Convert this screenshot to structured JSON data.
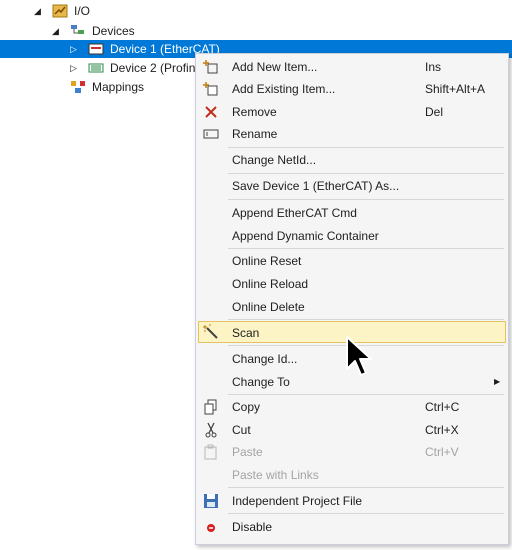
{
  "tree": {
    "io_label": "I/O",
    "devices_label": "Devices",
    "device1_label": "Device 1 (EtherCAT)",
    "device2_label": "Device 2 (Profin",
    "mappings_label": "Mappings"
  },
  "menu": {
    "add_new_item": "Add New Item...",
    "add_new_item_shortcut": "Ins",
    "add_existing_item": "Add Existing Item...",
    "add_existing_item_shortcut": "Shift+Alt+A",
    "remove": "Remove",
    "remove_shortcut": "Del",
    "rename": "Rename",
    "change_netid": "Change NetId...",
    "save_device_as": "Save Device 1 (EtherCAT) As...",
    "append_ethercat_cmd": "Append EtherCAT Cmd",
    "append_dynamic_container": "Append Dynamic Container",
    "online_reset": "Online Reset",
    "online_reload": "Online Reload",
    "online_delete": "Online Delete",
    "scan": "Scan",
    "change_id": "Change Id...",
    "change_to": "Change To",
    "copy": "Copy",
    "copy_shortcut": "Ctrl+C",
    "cut": "Cut",
    "cut_shortcut": "Ctrl+X",
    "paste": "Paste",
    "paste_shortcut": "Ctrl+V",
    "paste_with_links": "Paste with Links",
    "independent_project_file": "Independent Project File",
    "disable": "Disable"
  },
  "colors": {
    "selection": "#0078d7",
    "menu_background": "#f5f5f5",
    "highlight": "#fcf4c4",
    "disabled_text": "#a2a4a5"
  },
  "icons": {
    "expander_expanded": "triangle-down-icon",
    "expander_collapsed": "triangle-right-icon",
    "io": "io-folder-icon",
    "devices": "devices-icon",
    "device1": "ethercat-device-icon",
    "device2": "profinet-device-icon",
    "mappings": "mappings-icon"
  }
}
